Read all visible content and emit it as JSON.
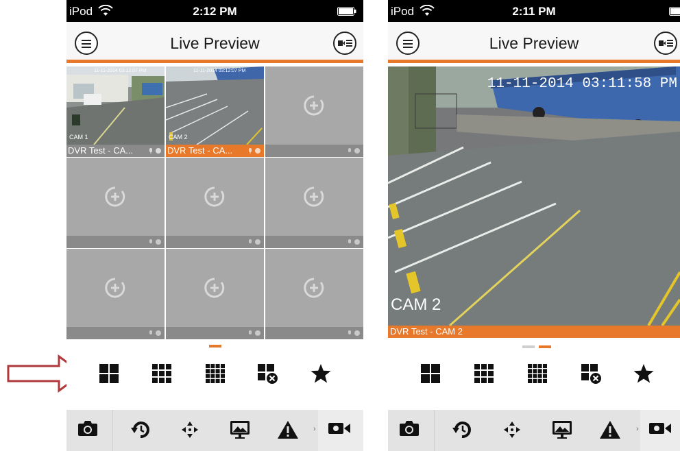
{
  "left_phone": {
    "status": {
      "carrier": "iPod",
      "time": "2:12 PM"
    },
    "nav": {
      "title": "Live Preview"
    },
    "grid": {
      "cells": [
        {
          "label": "DVR Test - CA...",
          "osd_cam": "CAM 1",
          "osd_time": "11-11-2014 03:12:07 PM",
          "active": false
        },
        {
          "label": "DVR Test - CA...",
          "osd_cam": "CAM 2",
          "osd_time": "11-11-2014 03:12:07 PM",
          "active": true
        },
        {
          "label": "",
          "active": false
        },
        {
          "label": "",
          "active": false
        },
        {
          "label": "",
          "active": false
        },
        {
          "label": "",
          "active": false
        },
        {
          "label": "",
          "active": false
        },
        {
          "label": "",
          "active": false
        },
        {
          "label": "",
          "active": false
        }
      ]
    },
    "page_indicator": {
      "pages": 1,
      "current": 1
    },
    "layout_buttons": [
      "layout-4-icon",
      "layout-9-icon",
      "layout-16-icon",
      "close-all-icon",
      "favorite-star-icon"
    ],
    "toolbar": [
      "snapshot-camera-icon",
      "playback-icon",
      "ptz-control-icon",
      "image-display-icon",
      "alarm-warning-icon",
      "record-video-icon"
    ]
  },
  "right_phone": {
    "status": {
      "carrier": "iPod",
      "time": "2:11 PM"
    },
    "nav": {
      "title": "Live Preview"
    },
    "single_view": {
      "osd_time": "11-11-2014 03:11:58 PM",
      "osd_cam": "CAM 2",
      "label": "DVR Test - CAM 2"
    },
    "page_indicator": {
      "pages": 2,
      "current": 2
    },
    "layout_buttons": [
      "layout-4-icon",
      "layout-9-icon",
      "layout-16-icon",
      "close-all-icon",
      "favorite-star-icon"
    ],
    "toolbar": [
      "snapshot-camera-icon",
      "playback-icon",
      "ptz-control-icon",
      "image-display-icon",
      "alarm-warning-icon",
      "record-video-icon"
    ]
  },
  "colors": {
    "accent": "#e8792b",
    "highlight_arrow": "#b0373a",
    "empty_cell": "#a8a8a8",
    "cell_bar": "#8a8a8a",
    "toolbar_bg": "#e3e3e3"
  }
}
